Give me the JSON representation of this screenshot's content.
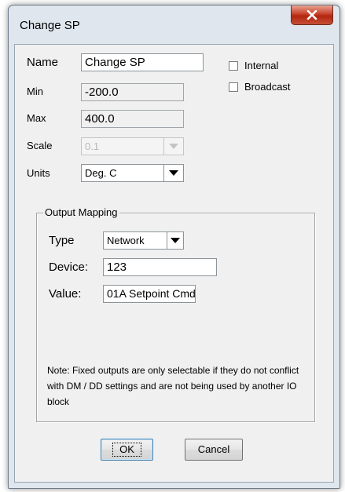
{
  "window": {
    "title": "Change SP"
  },
  "form": {
    "name_label": "Name",
    "name_value": "Change SP",
    "min_label": "Min",
    "min_value": "-200.0",
    "max_label": "Max",
    "max_value": "400.0",
    "scale_label": "Scale",
    "scale_value": "0.1",
    "units_label": "Units",
    "units_value": "Deg. C",
    "internal_label": "Internal",
    "internal_checked": false,
    "broadcast_label": "Broadcast",
    "broadcast_checked": false
  },
  "output_mapping": {
    "title": "Output Mapping",
    "type_label": "Type",
    "type_value": "Network",
    "device_label": "Device:",
    "device_value": "123",
    "value_label": "Value:",
    "value_value": "01A Setpoint Cmd",
    "note": "Note: Fixed outputs are only selectable if they do not conflict with DM / DD settings and are not being used by another IO block"
  },
  "buttons": {
    "ok": "OK",
    "cancel": "Cancel"
  },
  "colors": {
    "close_button": "#c8422c",
    "frame": "#dfe6ee",
    "client": "#f0f0f0"
  }
}
